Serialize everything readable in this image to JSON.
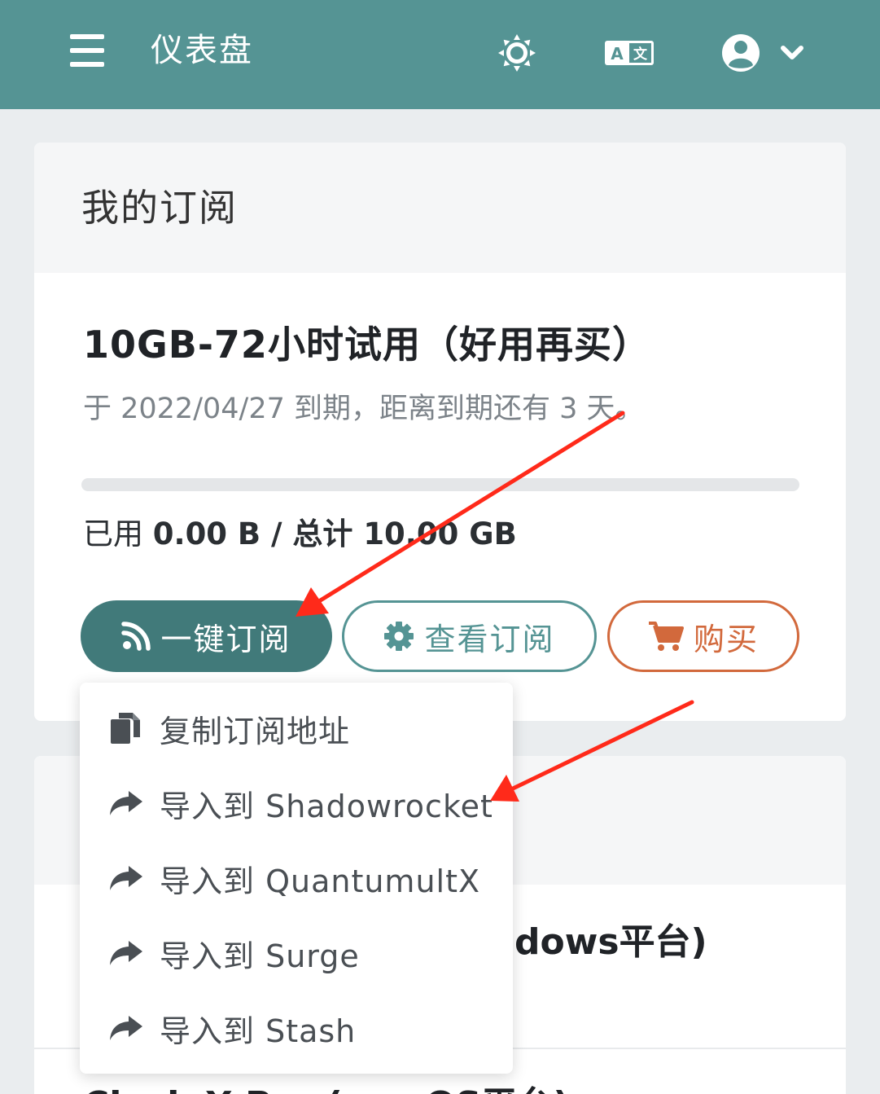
{
  "header": {
    "title": "仪表盘",
    "menu_icon": "hamburger-menu-icon",
    "theme_icon": "sun-icon",
    "lang_icon": "translate-icon",
    "user_icon": "user-circle-icon",
    "user_chevron": "chevron-down-icon",
    "bg_color": "#559494"
  },
  "subscription": {
    "heading": "我的订阅",
    "plan_name": "10GB-72小时试用（好用再买）",
    "expiry": "于 2022/04/27 到期，距离到期还有 3 天。",
    "progress_fraction": 0.0,
    "usage_prefix": "已用 ",
    "used": "0.00 B",
    "separator": " / 总计 ",
    "total": "10.00 GB",
    "buttons": {
      "subscribe": "一键订阅",
      "view": "查看订阅",
      "buy": "购买"
    }
  },
  "dropdown": {
    "items": [
      {
        "label": "复制订阅地址",
        "icon": "copy-icon"
      },
      {
        "label": "导入到 Shadowrocket",
        "icon": "share-arrow-icon"
      },
      {
        "label": "导入到 QuantumultX",
        "icon": "share-arrow-icon"
      },
      {
        "label": "导入到 Surge",
        "icon": "share-arrow-icon"
      },
      {
        "label": "导入到 Stash",
        "icon": "share-arrow-icon"
      }
    ]
  },
  "second_card": {
    "row1_visible": "dows平台)",
    "row2_visible": "Clash X Pro (macOS平台)"
  },
  "colors": {
    "accent": "#559494",
    "accent_dark": "#417a7a",
    "buy": "#d2693c",
    "annotation_arrow": "#ff2a1a"
  }
}
